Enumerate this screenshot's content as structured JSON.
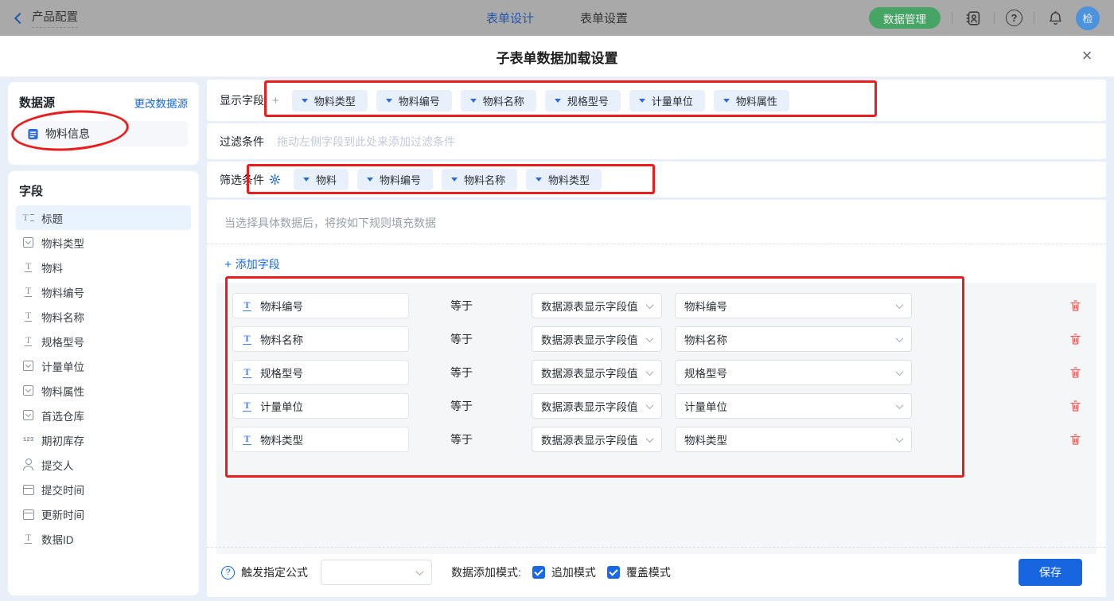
{
  "topbar": {
    "back_label": "产品配置",
    "tabs": [
      {
        "label": "表单设计"
      },
      {
        "label": "表单设置"
      }
    ],
    "data_manage_button": "数据管理",
    "avatar_text": "检"
  },
  "modal": {
    "title": "子表单数据加载设置"
  },
  "sidebar": {
    "datasource": {
      "title": "数据源",
      "change_link": "更改数据源",
      "item_label": "物料信息",
      "item_icon": "form-icon"
    },
    "fields_panel": {
      "title": "字段",
      "fields": [
        {
          "label": "标题",
          "icon": "title-field-icon"
        },
        {
          "label": "物料类型",
          "icon": "select-field-icon"
        },
        {
          "label": "物料",
          "icon": "text-field-icon"
        },
        {
          "label": "物料编号",
          "icon": "text-field-icon"
        },
        {
          "label": "物料名称",
          "icon": "text-field-icon"
        },
        {
          "label": "规格型号",
          "icon": "text-field-icon"
        },
        {
          "label": "计量单位",
          "icon": "select-field-icon"
        },
        {
          "label": "物料属性",
          "icon": "select-field-icon"
        },
        {
          "label": "首选仓库",
          "icon": "select-field-icon"
        },
        {
          "label": "期初库存",
          "icon": "number-field-icon"
        },
        {
          "label": "提交人",
          "icon": "user-field-icon"
        },
        {
          "label": "提交时间",
          "icon": "date-field-icon"
        },
        {
          "label": "更新时间",
          "icon": "date-field-icon"
        },
        {
          "label": "数据ID",
          "icon": "text-field-icon"
        }
      ]
    }
  },
  "main": {
    "display_fields": {
      "label": "显示字段",
      "add_button": "+",
      "tags": [
        "物料类型",
        "物料编号",
        "物料名称",
        "规格型号",
        "计量单位",
        "物料属性"
      ]
    },
    "filter_condition": {
      "label": "过滤条件",
      "placeholder": "拖动左侧字段到此处来添加过滤条件"
    },
    "screen_condition": {
      "label": "筛选条件",
      "tags": [
        "物料",
        "物料编号",
        "物料名称",
        "物料类型"
      ]
    },
    "fill_rules": {
      "hint": "当选择具体数据后，将按如下规则填充数据",
      "add_field_label": "添加字段",
      "rows": [
        {
          "field": "物料编号",
          "operator": "等于",
          "source": "数据源表显示字段值",
          "target": "物料编号"
        },
        {
          "field": "物料名称",
          "operator": "等于",
          "source": "数据源表显示字段值",
          "target": "物料名称"
        },
        {
          "field": "规格型号",
          "operator": "等于",
          "source": "数据源表显示字段值",
          "target": "规格型号"
        },
        {
          "field": "计量单位",
          "operator": "等于",
          "source": "数据源表显示字段值",
          "target": "计量单位"
        },
        {
          "field": "物料类型",
          "operator": "等于",
          "source": "数据源表显示字段值",
          "target": "物料类型"
        }
      ]
    },
    "footer": {
      "formula_label": "触发指定公式",
      "formula_value": "",
      "mode_label": "数据添加模式:",
      "modes": [
        {
          "label": "追加模式",
          "checked": true
        },
        {
          "label": "覆盖模式",
          "checked": true
        }
      ],
      "save_button": "保存"
    }
  },
  "colors": {
    "accent_blue": "#1868e8",
    "annotation_red": "#ec1c1c",
    "green_button": "#46a465",
    "avatar_blue": "#4d92dd"
  }
}
